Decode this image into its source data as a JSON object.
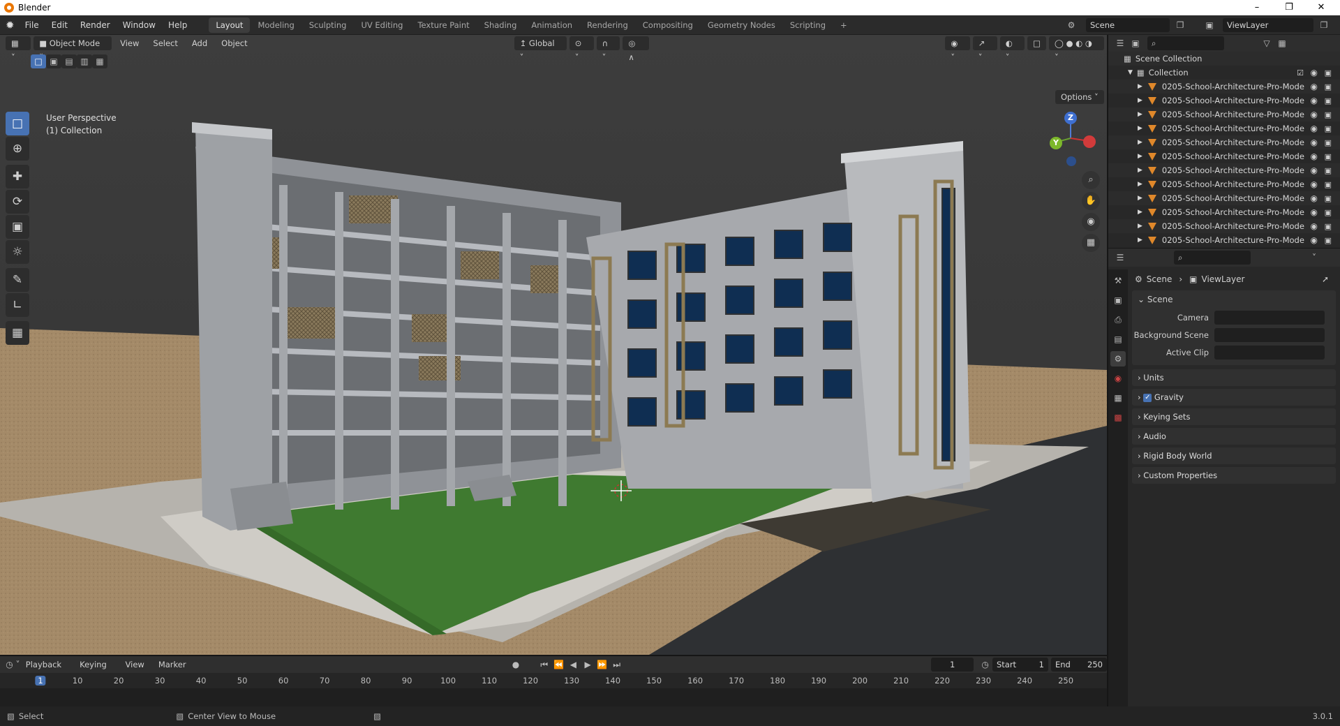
{
  "app": {
    "title": "Blender",
    "version": "3.0.1"
  },
  "menu": [
    "File",
    "Edit",
    "Render",
    "Window",
    "Help"
  ],
  "workspaces": [
    "Layout",
    "Modeling",
    "Sculpting",
    "UV Editing",
    "Texture Paint",
    "Shading",
    "Animation",
    "Rendering",
    "Compositing",
    "Geometry Nodes",
    "Scripting"
  ],
  "active_workspace": "Layout",
  "scene_field": "Scene",
  "viewlayer_field": "ViewLayer",
  "viewport_header": {
    "mode": "Object Mode",
    "menus": [
      "View",
      "Select",
      "Add",
      "Object"
    ],
    "orientation": "Global",
    "options_label": "Options"
  },
  "viewport": {
    "perspective": "User Perspective",
    "collection": "(1) Collection",
    "gizmo": {
      "z": "Z",
      "y": "Y",
      "x": "X"
    }
  },
  "outliner": {
    "scene_collection": "Scene Collection",
    "collection": "Collection",
    "items": [
      "0205-School-Architecture-Pro-Mode",
      "0205-School-Architecture-Pro-Mode",
      "0205-School-Architecture-Pro-Mode",
      "0205-School-Architecture-Pro-Mode",
      "0205-School-Architecture-Pro-Mode",
      "0205-School-Architecture-Pro-Mode",
      "0205-School-Architecture-Pro-Mode",
      "0205-School-Architecture-Pro-Mode",
      "0205-School-Architecture-Pro-Mode",
      "0205-School-Architecture-Pro-Mode",
      "0205-School-Architecture-Pro-Mode",
      "0205-School-Architecture-Pro-Mode"
    ]
  },
  "properties": {
    "breadcrumb": [
      "Scene",
      "ViewLayer"
    ],
    "scene_panel": "Scene",
    "fields": [
      {
        "label": "Camera"
      },
      {
        "label": "Background Scene"
      },
      {
        "label": "Active Clip"
      }
    ],
    "panels": [
      "Units",
      "Gravity",
      "Keying Sets",
      "Audio",
      "Rigid Body World",
      "Custom Properties"
    ],
    "gravity_checked": true
  },
  "timeline": {
    "menus": [
      "Playback",
      "Keying",
      "View",
      "Marker"
    ],
    "current_frame": "1",
    "start_label": "Start",
    "start": "1",
    "end_label": "End",
    "end": "250",
    "ruler": [
      "1",
      "10",
      "20",
      "30",
      "40",
      "50",
      "60",
      "70",
      "80",
      "90",
      "100",
      "110",
      "120",
      "130",
      "140",
      "150",
      "160",
      "170",
      "180",
      "190",
      "200",
      "210",
      "220",
      "230",
      "240",
      "250"
    ]
  },
  "status": {
    "select": "Select",
    "center": "Center View to Mouse",
    "version": "3.0.1"
  }
}
